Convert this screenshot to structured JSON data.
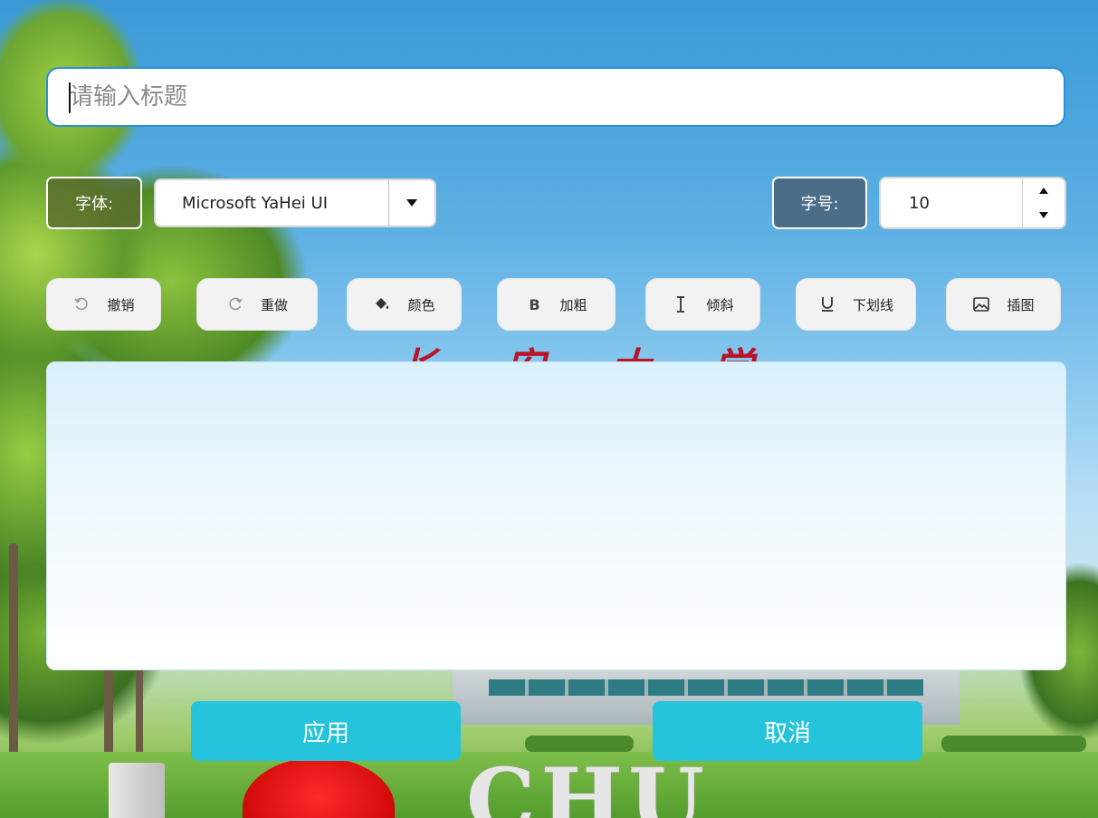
{
  "title_input": {
    "placeholder": "请输入标题",
    "value": ""
  },
  "font": {
    "label": "字体:",
    "selected": "Microsoft YaHei UI"
  },
  "size": {
    "label": "字号:",
    "value": "10"
  },
  "toolbar": {
    "undo": "撤销",
    "redo": "重做",
    "color": "颜色",
    "bold": "加粗",
    "italic": "倾斜",
    "underline": "下划线",
    "image": "插图"
  },
  "actions": {
    "apply": "应用",
    "cancel": "取消"
  },
  "background": {
    "gate_text": [
      "长",
      "安",
      "大",
      "学"
    ],
    "sign_letters": [
      "C",
      "H",
      "U"
    ]
  },
  "colors": {
    "accent": "#25c4dc",
    "title_border": "#2b8ed8",
    "size_label_bg": "#4b6d88"
  }
}
